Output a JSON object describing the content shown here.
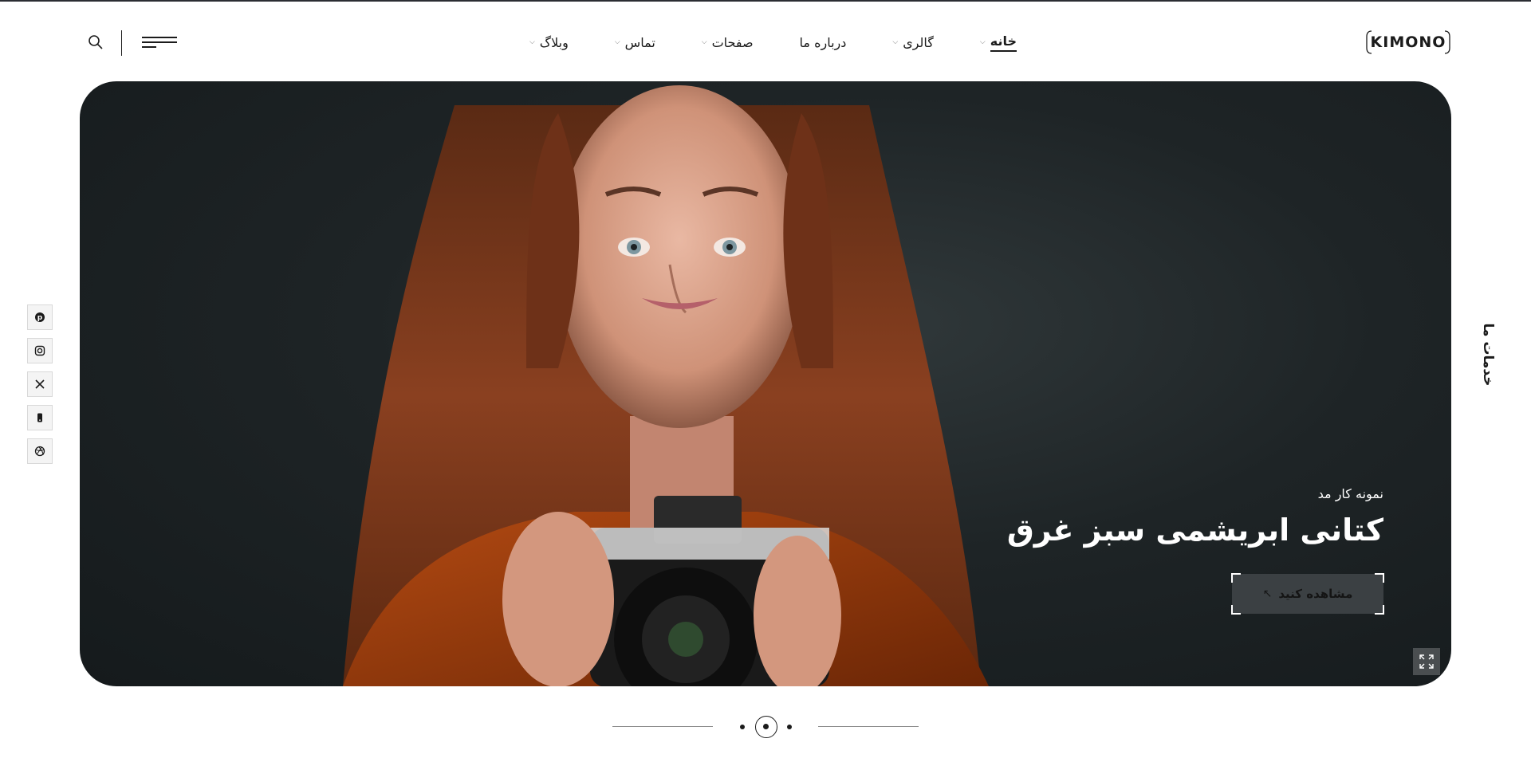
{
  "logo": {
    "text": "KIMONO"
  },
  "nav": {
    "items": [
      {
        "label": "خانه",
        "has_dropdown": true,
        "active": true
      },
      {
        "label": "گالری",
        "has_dropdown": true,
        "active": false
      },
      {
        "label": "درباره ما",
        "has_dropdown": false,
        "active": false
      },
      {
        "label": "صفحات",
        "has_dropdown": true,
        "active": false
      },
      {
        "label": "تماس",
        "has_dropdown": true,
        "active": false
      },
      {
        "label": "وبلاگ",
        "has_dropdown": true,
        "active": false
      }
    ]
  },
  "header_icons": [
    "search-icon",
    "menu-icon"
  ],
  "hero": {
    "subtitle": "نمونه کار مد",
    "title": "کتانی ابریشمی سبز غرق",
    "cta_label": "مشاهده کنید",
    "cta_icon": "arrow-up-left-icon",
    "expand_icon": "fullscreen-icon"
  },
  "services_label": "خدمات ما",
  "social_icons": [
    "pinterest-icon",
    "instagram-icon",
    "x-icon",
    "phone-icon",
    "dribbble-icon"
  ],
  "pagination": {
    "total": 3,
    "active_index": 1
  },
  "colors": {
    "accent": "#1b1b1b",
    "hero_bg": "#1e2426",
    "cta_bg": "#3b4043"
  }
}
